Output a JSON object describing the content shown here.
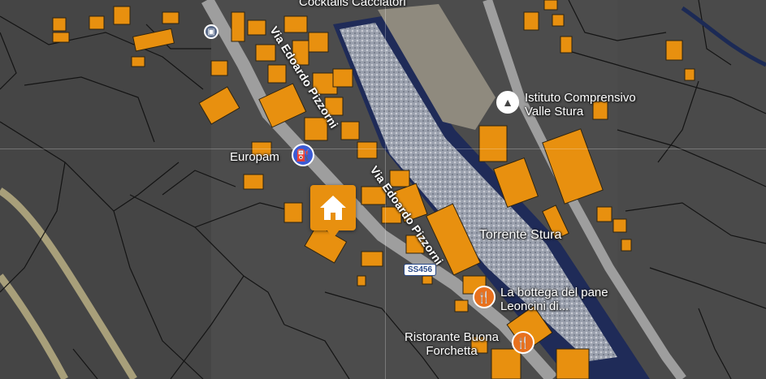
{
  "labels": {
    "top_place": "Cocktails Cacciatori",
    "school": "Istituto Comprensivo Valle Stura",
    "europam": "Europam",
    "river": "Torrente Stura",
    "street_upper": "Via Edoardo Pizzorni",
    "street_lower": "Via Edoardo Pizzorni",
    "road_shield": "SS456",
    "bakery": "La bottega del pane Leoncini di...",
    "restaurant": "Ristorante Buona Forchetta"
  },
  "icons": {
    "school": "school-icon",
    "fuel": "fuel-station-icon",
    "restaurant": "fork-knife-icon",
    "home": "home-icon",
    "bus": "bus-stop-icon"
  },
  "colors": {
    "building": "#e8900f",
    "building_border": "#3a2a10",
    "parcel_line": "#1a1a1a",
    "terrain": "#4d4d4d",
    "river": "#2a3a66",
    "road": "#a89f88",
    "restaurant_pin": "#e8711e",
    "fuel_pin": "#3b5bd6",
    "school_pin": "#ffffff"
  }
}
